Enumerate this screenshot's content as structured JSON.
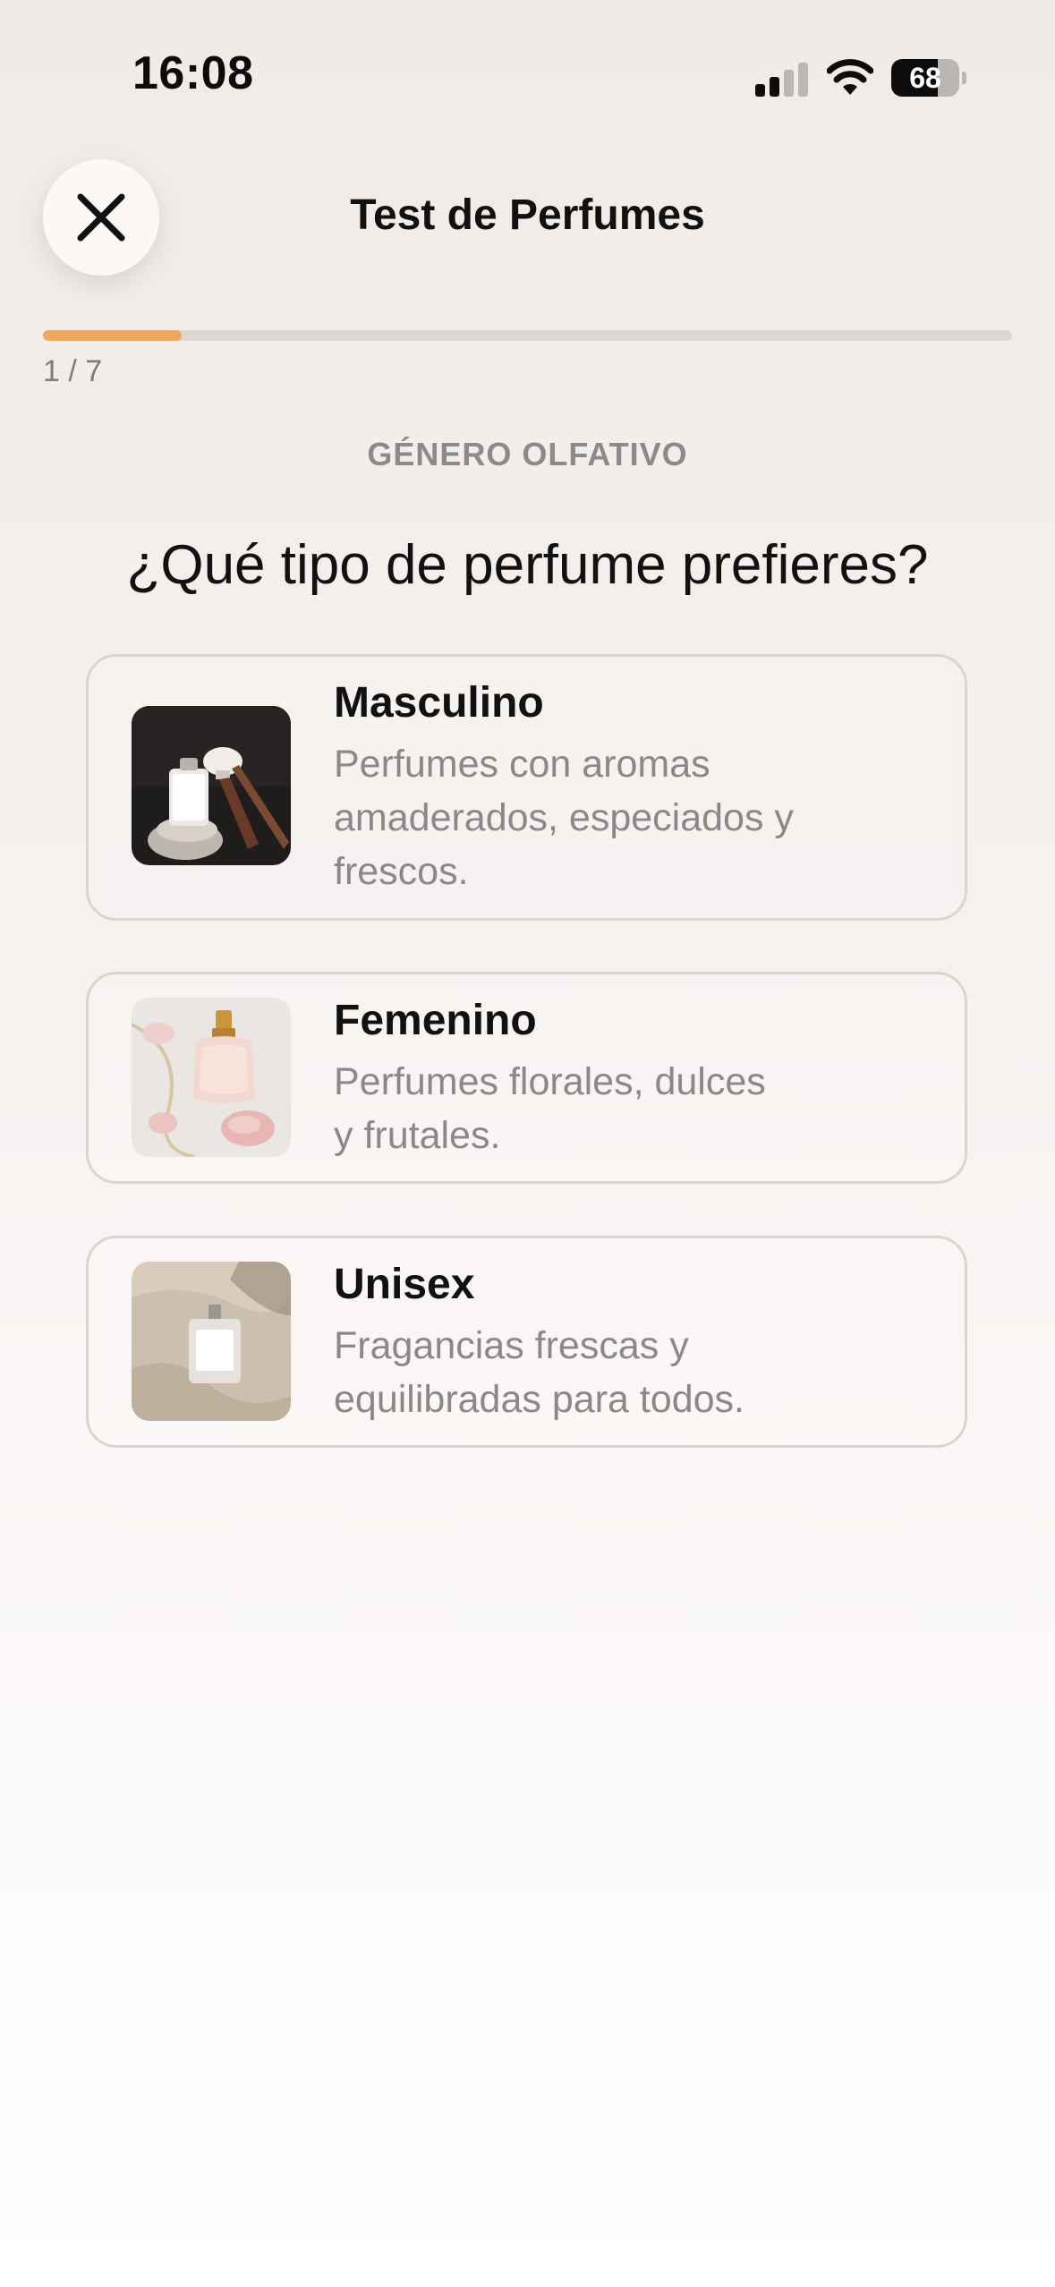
{
  "status_bar": {
    "time": "16:08",
    "battery_level": "68",
    "battery_fraction": 0.68
  },
  "header": {
    "title": "Test de Perfumes",
    "close_icon": "close-icon"
  },
  "progress": {
    "current": 1,
    "total": 7,
    "label": "1 / 7",
    "color": "#f0a75e"
  },
  "section": {
    "label": "GÉNERO OLFATIVO"
  },
  "question": {
    "title": "¿Qué tipo de perfume prefieres?"
  },
  "options": [
    {
      "title": "Masculino",
      "description_lines": [
        "Perfumes con aromas",
        "amaderados, especiados y",
        "frescos."
      ]
    },
    {
      "title": "Femenino",
      "description_lines": [
        "Perfumes florales, dulces",
        "y frutales."
      ]
    },
    {
      "title": "Unisex",
      "description_lines": [
        "Fragancias frescas y",
        "equilibradas para todos."
      ]
    }
  ]
}
